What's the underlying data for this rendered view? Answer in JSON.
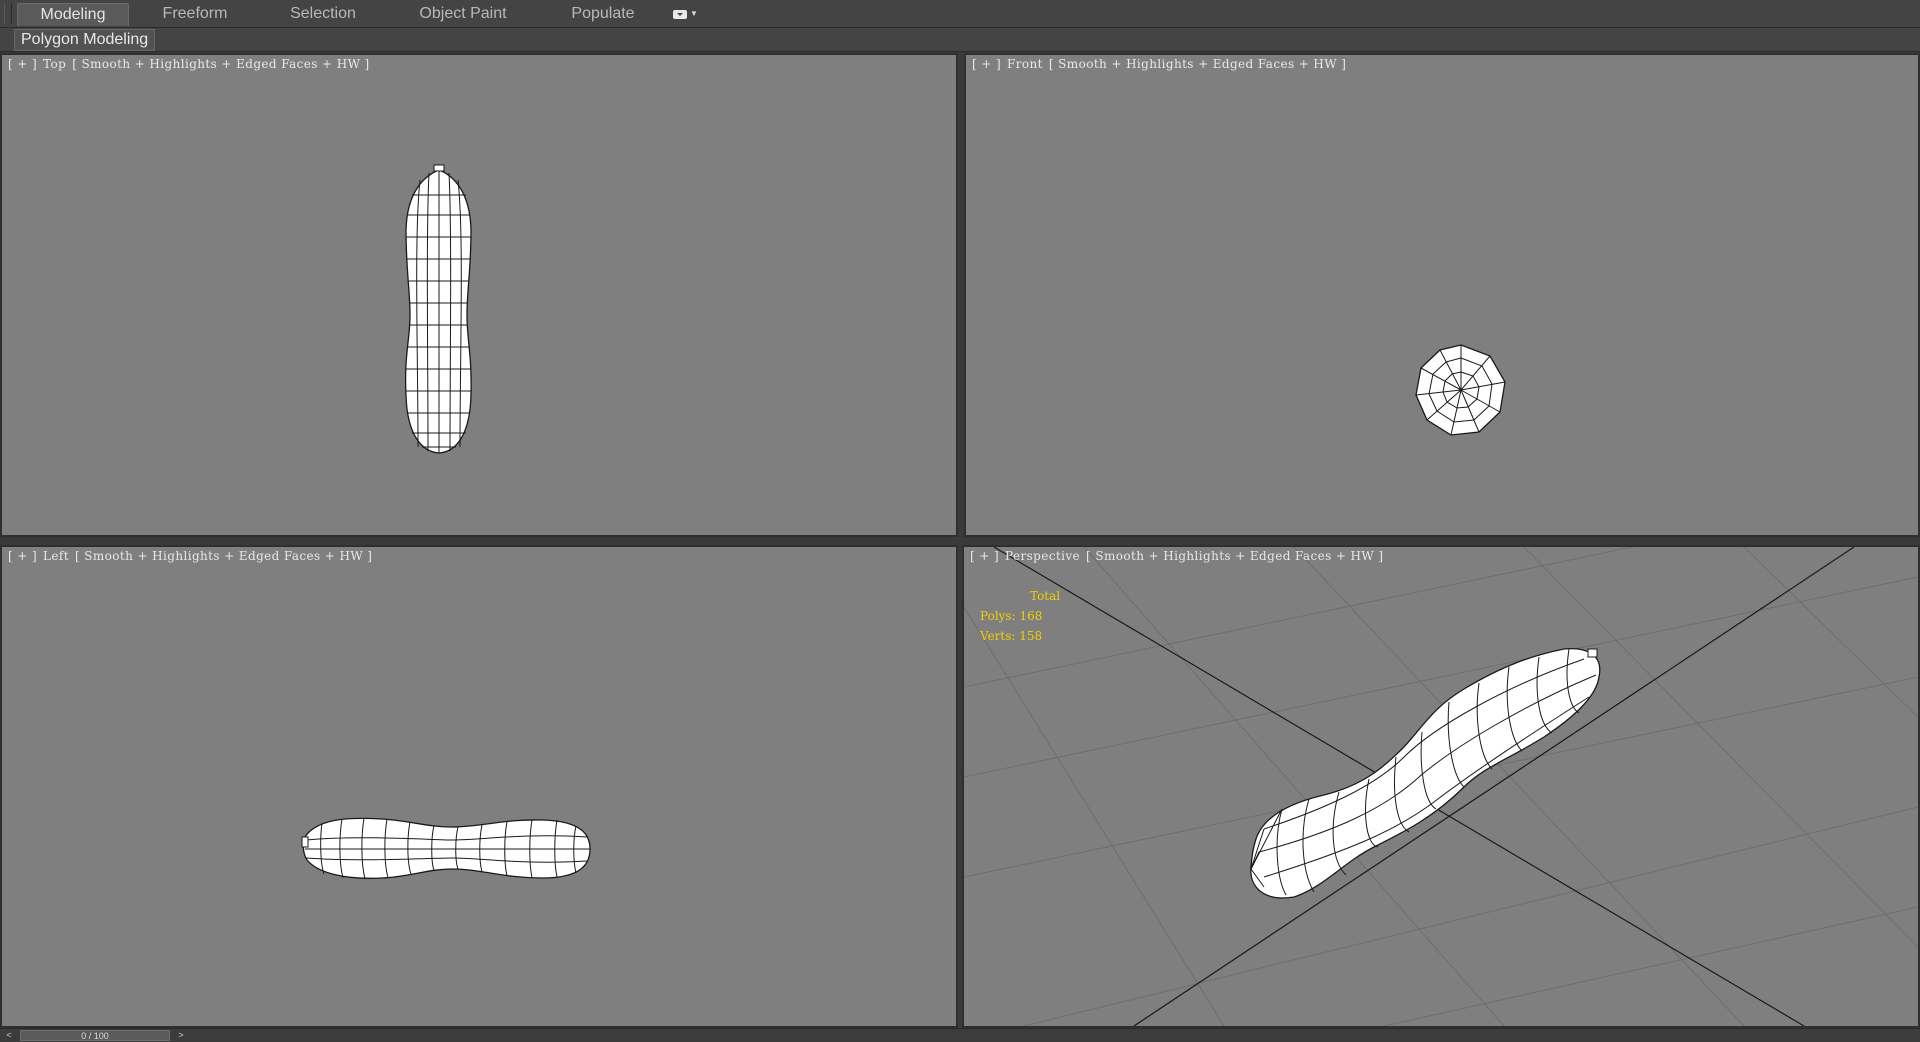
{
  "ribbon": {
    "tabs": [
      {
        "label": "Modeling",
        "active": true
      },
      {
        "label": "Freeform",
        "active": false
      },
      {
        "label": "Selection",
        "active": false
      },
      {
        "label": "Object Paint",
        "active": false
      },
      {
        "label": "Populate",
        "active": false
      }
    ],
    "options_icon": "ribbon-options-icon"
  },
  "panel": {
    "label": "Polygon Modeling"
  },
  "viewports": {
    "top": {
      "plus": "[ + ]",
      "view": "Top",
      "shading": "[ Smooth + Highlights + Edged Faces + HW ]"
    },
    "front": {
      "plus": "[ + ]",
      "view": "Front",
      "shading": "[ Smooth + Highlights + Edged Faces + HW ]"
    },
    "left": {
      "plus": "[ + ]",
      "view": "Left",
      "shading": "[ Smooth + Highlights + Edged Faces + HW ]"
    },
    "perspective": {
      "plus": "[ + ]",
      "view": "Perspective",
      "shading": "[ Smooth + Highlights + Edged Faces + HW ]",
      "stats": {
        "total_label": "Total",
        "polys": "Polys: 168",
        "verts": "Verts: 158"
      }
    }
  },
  "timeslider": {
    "value": "0 / 100",
    "prev": "<",
    "next": ">"
  },
  "colors": {
    "viewport_bg": "#7f7f7f",
    "stats_text": "#f0d000",
    "mesh_fill": "#ffffff",
    "wire": "#1a1a1a"
  }
}
